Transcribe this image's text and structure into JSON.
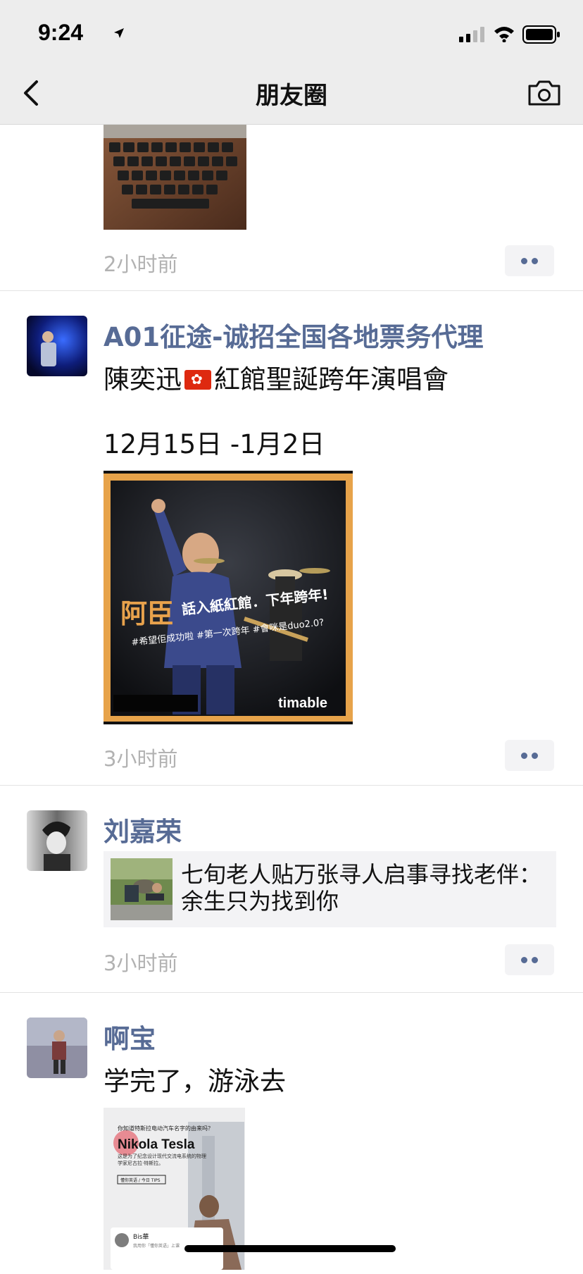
{
  "status": {
    "time": "9:24"
  },
  "nav": {
    "title": "朋友圈"
  },
  "posts": [
    {
      "time": "2小时前"
    },
    {
      "name": "A01征途-诚招全国各地票务代理",
      "text_line1_a": "陳奕迅",
      "text_line1_b": "紅館聖誕跨年演唱會",
      "text_line2": "12月15日 -1月2日",
      "image": {
        "overlay_main": "阿臣",
        "overlay_line1": "話入紙紅館．下年跨年!",
        "overlay_line2": "#希望佢成功啦 #第一次跨年 #會咪是duo2.0?",
        "watermark": "timable"
      },
      "time": "3小时前"
    },
    {
      "name": "刘嘉荣",
      "link_title": "七旬老人贴万张寻人启事寻找老伴：\n余生只为找到你",
      "time": "3小时前"
    },
    {
      "name": "啊宝",
      "text": "学完了，游泳去",
      "image": {
        "question": "你知道特斯拉电动汽车名字的由来吗？",
        "heading": "Nikola Tesla",
        "desc": "这是为了纪念设计现代交流电系统的物理学家尼古拉·特斯拉。",
        "tag": "懂你英语 / 今日 TIPS",
        "card_name": "Bis華",
        "card_sub": "我用你「懂你英语」上课"
      }
    }
  ]
}
